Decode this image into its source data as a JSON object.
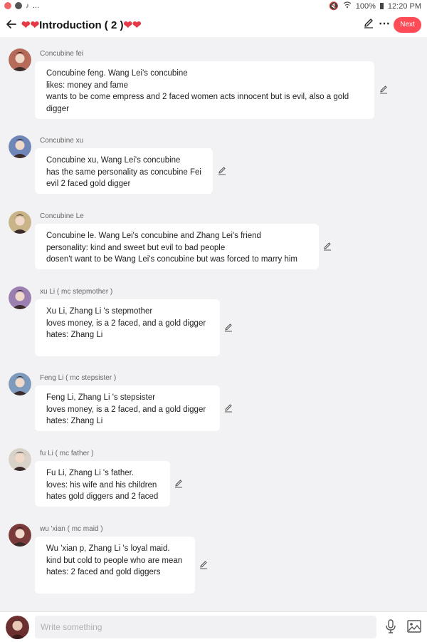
{
  "status_bar": {
    "left_more": "...",
    "battery": "100%",
    "time": "12:20 PM"
  },
  "header": {
    "hearts_left": "❤❤",
    "title": "Introduction ( 2 )",
    "hearts_right": "❤❤",
    "next_label": "Next"
  },
  "messages": [
    {
      "name": "Concubine fei",
      "lines": [
        "Concubine feng. Wang Lei's concubine",
        "likes: money and fame",
        "wants to be come empress and 2 faced women acts innocent but is evil, also a gold",
        "digger"
      ],
      "avatar_color": "#b56a5a"
    },
    {
      "name": "Concubine xu",
      "lines": [
        "Concubine xu, Wang Lei's concubine",
        "has the same personality as concubine Fei",
        "evil 2 faced gold digger"
      ],
      "avatar_color": "#6f86b9"
    },
    {
      "name": "Concubine Le",
      "lines": [
        "Concubine le. Wang Lei's concubine and Zhang Lei's friend",
        "personality: kind and sweet but evil to bad people",
        "dosen't want to be Wang Lei's concubine but was forced to marry him"
      ],
      "avatar_color": "#c9b48a"
    },
    {
      "name": "xu Li ( mc stepmother )",
      "lines": [
        "Xu Li, Zhang Li 's stepmother",
        "loves money, is a 2 faced, and a gold digger",
        "hates: Zhang Li"
      ],
      "avatar_color": "#9a7fb0"
    },
    {
      "name": "Feng Li ( mc stepsister )",
      "lines": [
        "Feng Li, Zhang Li 's stepsister",
        "loves money, is a 2 faced, and a gold digger",
        "hates: Zhang Li"
      ],
      "avatar_color": "#7e9bbd"
    },
    {
      "name": "fu Li ( mc father )",
      "lines": [
        "Fu Li, Zhang Li 's father.",
        "loves: his wife and his children",
        "hates gold diggers and 2 faced"
      ],
      "avatar_color": "#d8d2c8"
    },
    {
      "name": "wu 'xian ( mc maid )",
      "lines": [
        "Wu 'xian p, Zhang Li 's loyal maid.",
        "kind but cold to people who are mean",
        "hates: 2 faced and gold diggers"
      ],
      "avatar_color": "#7a3a3a"
    }
  ],
  "composer": {
    "placeholder": "Write something"
  },
  "icons": {
    "back": "arrow-left-icon",
    "edit": "pencil-icon",
    "more": "more-icon",
    "mic": "microphone-icon",
    "image": "image-icon"
  },
  "colors": {
    "accent": "#ff4b55",
    "heart": "#e53946",
    "background": "#f2f2f4"
  }
}
